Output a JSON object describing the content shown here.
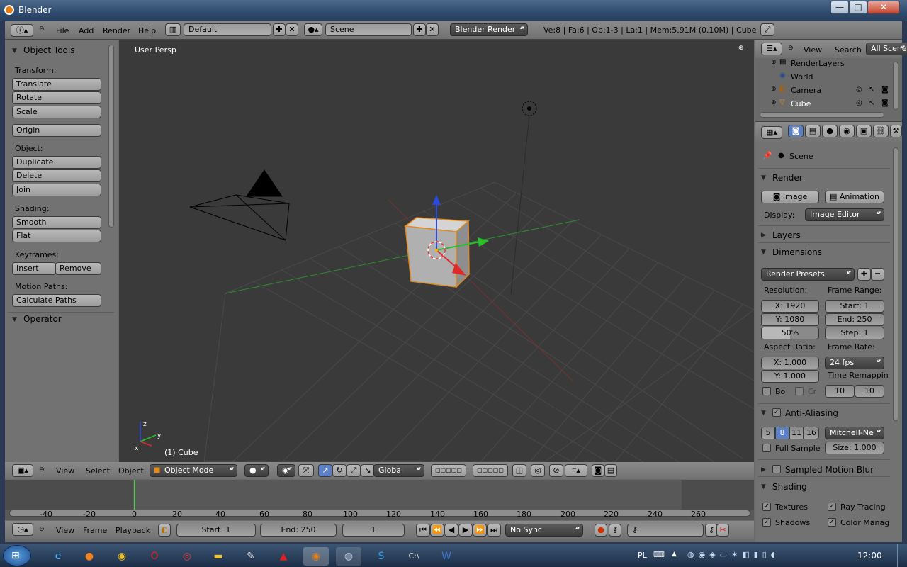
{
  "window": {
    "title": "Blender",
    "min": "—",
    "max": "□",
    "close": "✕"
  },
  "info_header": {
    "menus": [
      "File",
      "Add",
      "Render",
      "Help"
    ],
    "screen": "Default",
    "scene": "Scene",
    "engine": "Blender Render",
    "stats": "Ve:8 | Fa:6 | Ob:1-3 | La:1 | Mem:5.91M (0.10M) | Cube"
  },
  "tool_shelf": {
    "title": "Object Tools",
    "transform_label": "Transform:",
    "translate": "Translate",
    "rotate": "Rotate",
    "scale": "Scale",
    "origin": "Origin",
    "object_label": "Object:",
    "duplicate": "Duplicate",
    "delete": "Delete",
    "join": "Join",
    "shading_label": "Shading:",
    "smooth": "Smooth",
    "flat": "Flat",
    "keyframes_label": "Keyframes:",
    "insert": "Insert",
    "remove": "Remove",
    "motion_label": "Motion Paths:",
    "calculate": "Calculate Paths",
    "operator": "Operator"
  },
  "viewport": {
    "view_name": "User Persp",
    "object_name": "(1) Cube"
  },
  "view3d_header": {
    "menus": [
      "View",
      "Select",
      "Object"
    ],
    "mode": "Object Mode",
    "orientation": "Global"
  },
  "timeline": {
    "ruler": [
      "-40",
      "-20",
      "0",
      "20",
      "40",
      "60",
      "80",
      "100",
      "120",
      "140",
      "160",
      "180",
      "200",
      "220",
      "240",
      "260"
    ],
    "menus": [
      "View",
      "Frame",
      "Playback"
    ],
    "start": "Start: 1",
    "end": "End: 250",
    "current": "1",
    "sync": "No Sync"
  },
  "outliner": {
    "menus": [
      "View",
      "Search"
    ],
    "filter": "All Scene",
    "items": [
      "RenderLayers",
      "World",
      "Camera",
      "Cube"
    ]
  },
  "properties": {
    "context": "Scene",
    "render_panel": "Render",
    "image_btn": "Image",
    "animation_btn": "Animation",
    "display_label": "Display:",
    "display_value": "Image Editor",
    "layers_panel": "Layers",
    "dimensions_panel": "Dimensions",
    "render_presets": "Render Presets",
    "resolution_label": "Resolution:",
    "res_x": "X: 1920",
    "res_y": "Y: 1080",
    "res_pct": "50%",
    "frame_range_label": "Frame Range:",
    "start": "Start: 1",
    "end": "End: 250",
    "step": "Step: 1",
    "aspect_label": "Aspect Ratio:",
    "asp_x": "X: 1.000",
    "asp_y": "Y: 1.000",
    "frame_rate_label": "Frame Rate:",
    "fps": "24 fps",
    "time_remap_label": "Time Remappin",
    "remap_old": "10",
    "remap_new": "10",
    "border": "Bo",
    "crop": "Cr",
    "aa_panel": "Anti-Aliasing",
    "aa_samples": [
      "5",
      "8",
      "11",
      "16"
    ],
    "aa_filter": "Mitchell-Ne",
    "full_sample": "Full Sample",
    "aa_size": "Size: 1.000",
    "motion_blur_panel": "Sampled Motion Blur",
    "shading_panel": "Shading",
    "textures": "Textures",
    "ray_tracing": "Ray Tracing",
    "shadows": "Shadows",
    "color_manag": "Color Manag"
  },
  "taskbar": {
    "lang": "PL",
    "clock": "12:00"
  }
}
